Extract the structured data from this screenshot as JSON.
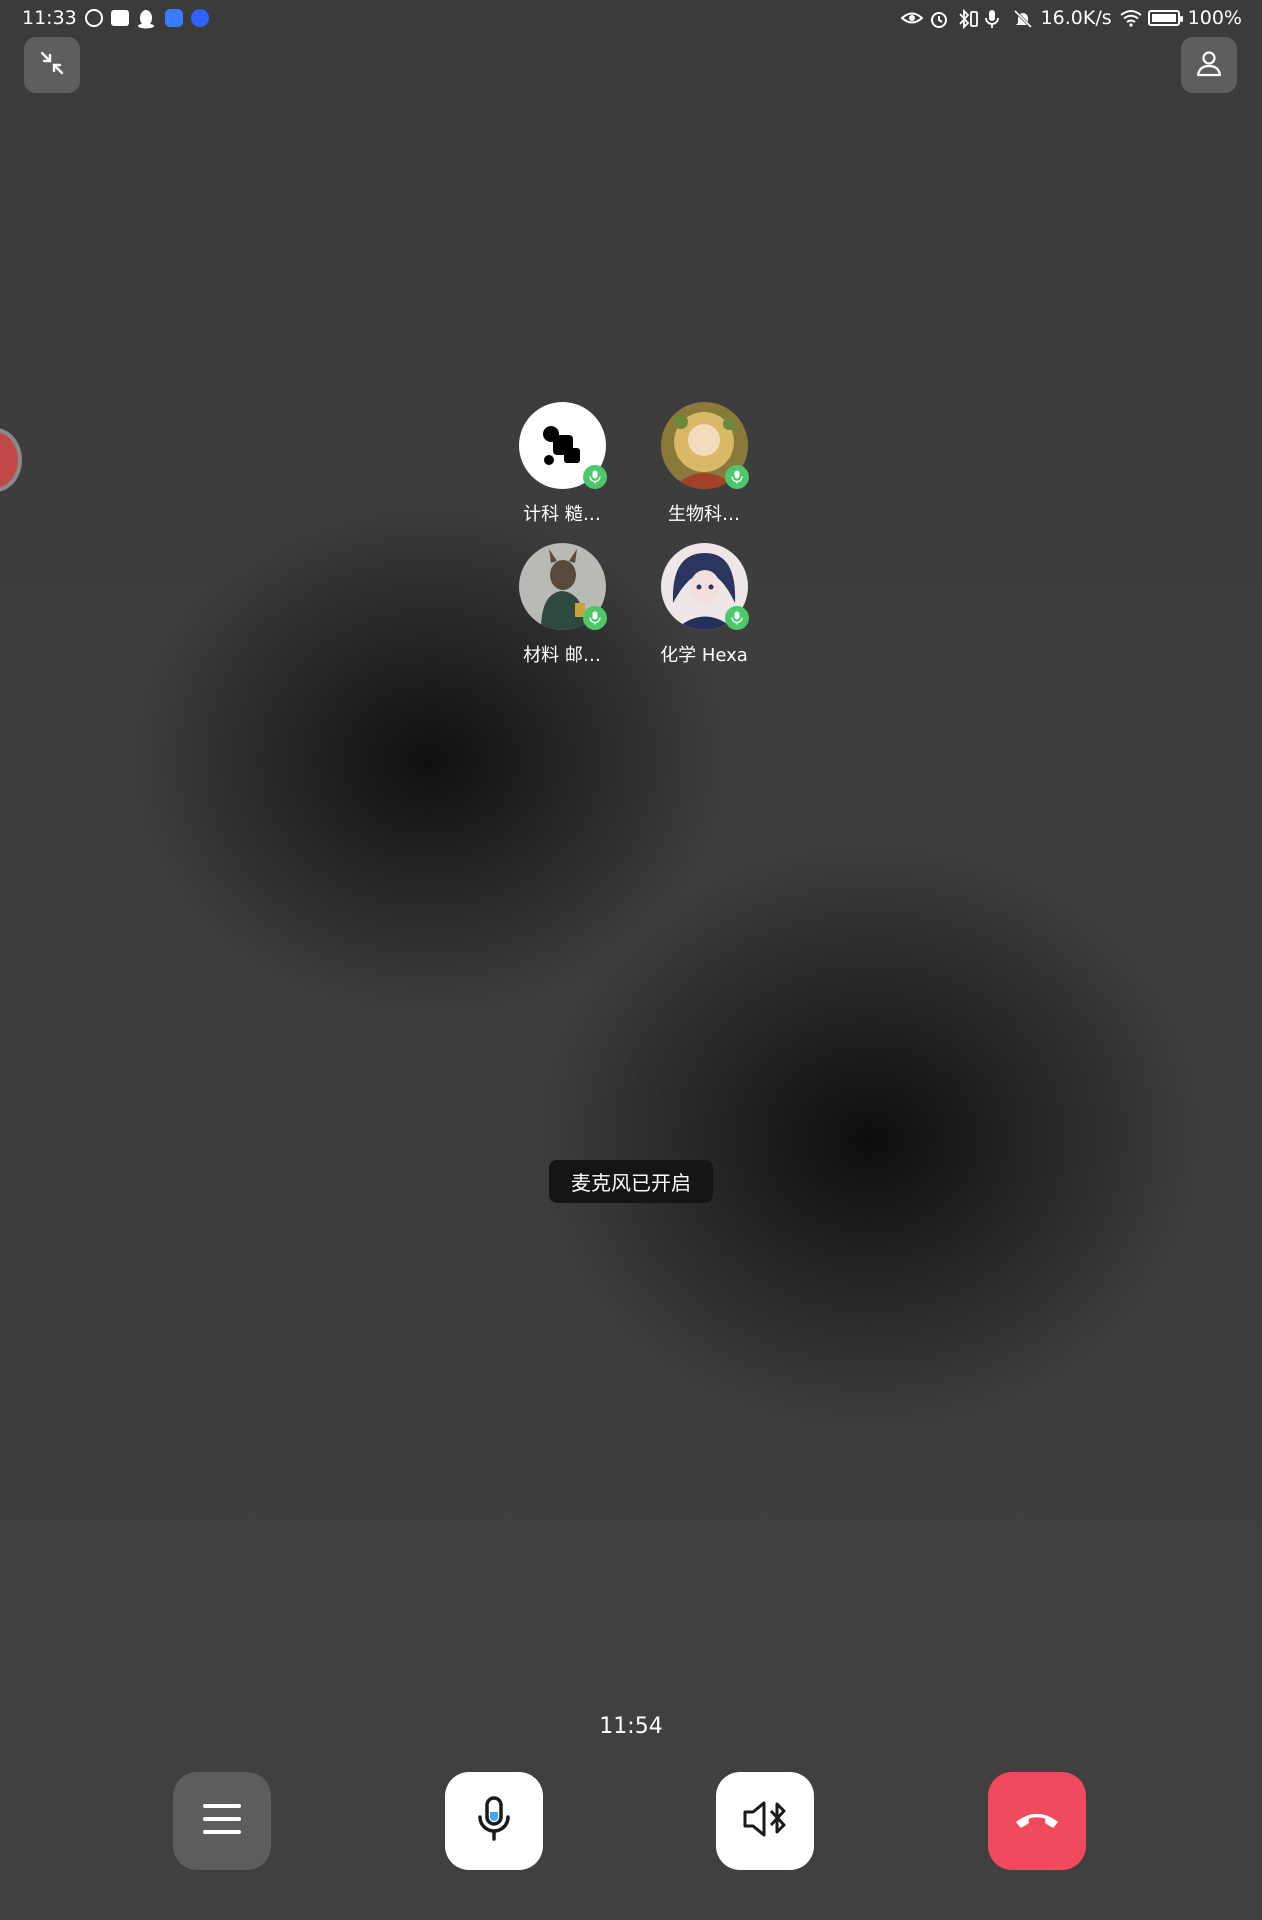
{
  "status_bar": {
    "time": "11:33",
    "net_speed": "16.0K/s",
    "battery": "100%",
    "left_icons": [
      "headset-icon",
      "video-icon",
      "qq-icon",
      "cloud-icon",
      "cloud-circle-icon"
    ],
    "right_icons": [
      "eye-icon",
      "alarm-icon",
      "bluetooth-battery-icon",
      "mic-icon",
      "mute-bell-icon",
      "wifi-icon",
      "battery-icon"
    ]
  },
  "top_controls": {
    "left_icon": "shrink-window-icon",
    "right_icon": "person-icon"
  },
  "participants": [
    {
      "name": "计科 糙…",
      "avatar_style": "logo-dots",
      "mic": "on"
    },
    {
      "name": "生物科…",
      "avatar_style": "anime-girl-gold",
      "mic": "on"
    },
    {
      "name": "材料 邮…",
      "avatar_style": "wolf-character",
      "mic": "on"
    },
    {
      "name": "化学 Hexa",
      "avatar_style": "anime-girl-blue",
      "mic": "on"
    }
  ],
  "toast": "麦克风已开启",
  "call_timer": "11:54",
  "bottom_controls": {
    "menu_icon": "menu-icon",
    "mic_icon": "microphone-icon",
    "speaker_icon": "bluetooth-speaker-icon",
    "hangup_icon": "hang-up-icon"
  },
  "colors": {
    "hangup": "#f04a5e",
    "mic_badge": "#4cc76a",
    "mic_accent": "#3fa9f5"
  }
}
